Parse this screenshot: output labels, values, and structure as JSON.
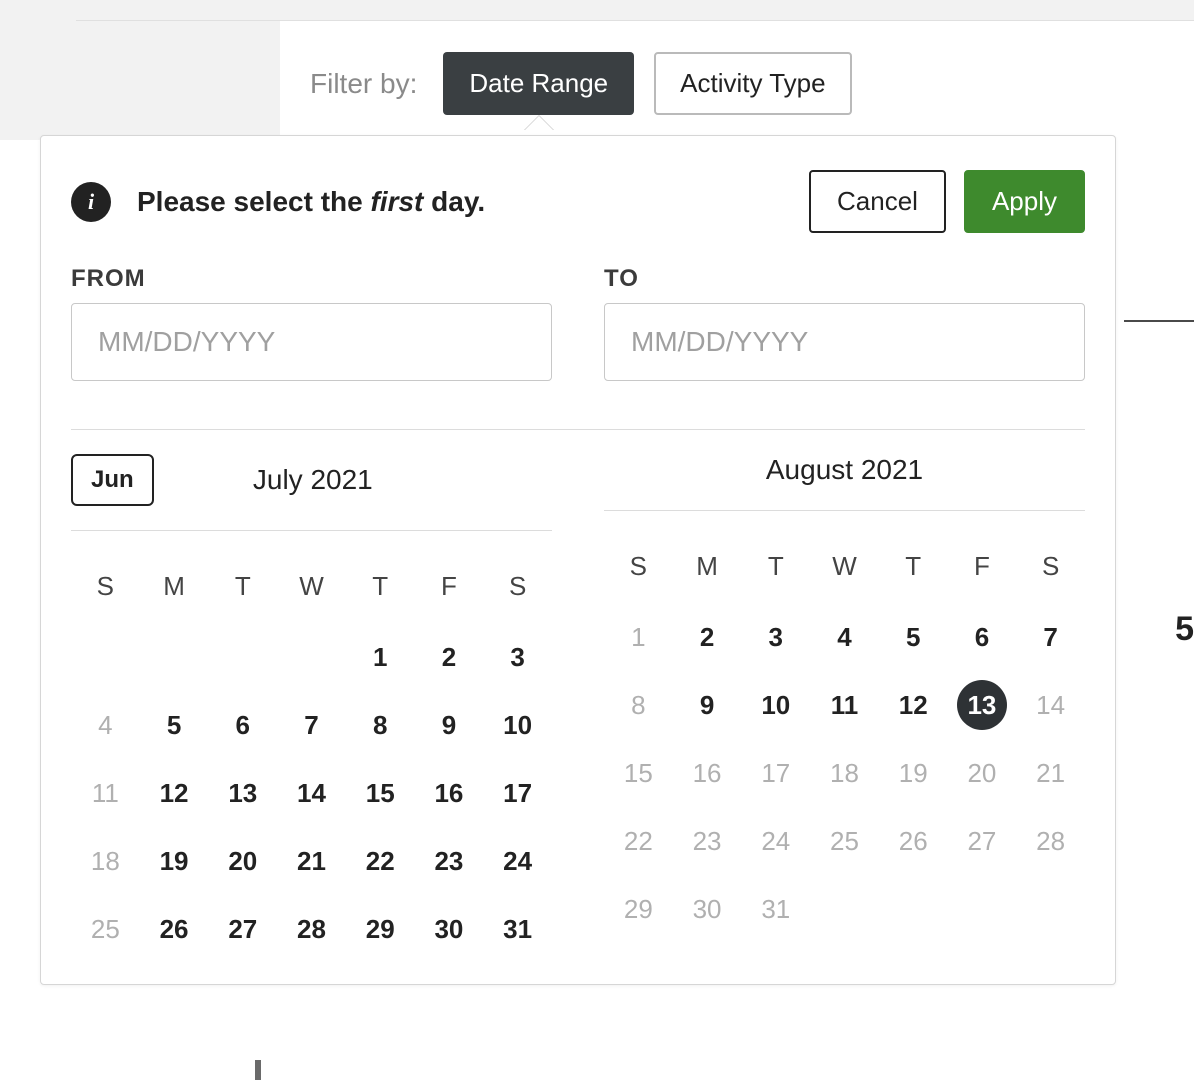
{
  "filter": {
    "label": "Filter by:",
    "buttons": {
      "date_range": "Date Range",
      "activity_type": "Activity Type"
    }
  },
  "popover": {
    "info_prefix": "Please select the ",
    "info_em": "first",
    "info_suffix": " day.",
    "cancel": "Cancel",
    "apply": "Apply",
    "from_label": "FROM",
    "to_label": "TO",
    "from_value": "",
    "to_value": "",
    "placeholder": "MM/DD/YYYY"
  },
  "calendars": {
    "prev_label": "Jun",
    "weekdays": [
      "S",
      "M",
      "T",
      "W",
      "T",
      "F",
      "S"
    ],
    "left": {
      "title": "July 2021",
      "cells": [
        {
          "n": "",
          "t": "empty"
        },
        {
          "n": "",
          "t": "empty"
        },
        {
          "n": "",
          "t": "empty"
        },
        {
          "n": "",
          "t": "empty"
        },
        {
          "n": "1",
          "t": ""
        },
        {
          "n": "2",
          "t": ""
        },
        {
          "n": "3",
          "t": ""
        },
        {
          "n": "4",
          "t": "dim"
        },
        {
          "n": "5",
          "t": ""
        },
        {
          "n": "6",
          "t": ""
        },
        {
          "n": "7",
          "t": ""
        },
        {
          "n": "8",
          "t": ""
        },
        {
          "n": "9",
          "t": ""
        },
        {
          "n": "10",
          "t": ""
        },
        {
          "n": "11",
          "t": "dim"
        },
        {
          "n": "12",
          "t": ""
        },
        {
          "n": "13",
          "t": ""
        },
        {
          "n": "14",
          "t": ""
        },
        {
          "n": "15",
          "t": ""
        },
        {
          "n": "16",
          "t": ""
        },
        {
          "n": "17",
          "t": ""
        },
        {
          "n": "18",
          "t": "dim"
        },
        {
          "n": "19",
          "t": ""
        },
        {
          "n": "20",
          "t": ""
        },
        {
          "n": "21",
          "t": ""
        },
        {
          "n": "22",
          "t": ""
        },
        {
          "n": "23",
          "t": ""
        },
        {
          "n": "24",
          "t": ""
        },
        {
          "n": "25",
          "t": "dim"
        },
        {
          "n": "26",
          "t": ""
        },
        {
          "n": "27",
          "t": ""
        },
        {
          "n": "28",
          "t": ""
        },
        {
          "n": "29",
          "t": ""
        },
        {
          "n": "30",
          "t": ""
        },
        {
          "n": "31",
          "t": ""
        }
      ]
    },
    "right": {
      "title": "August 2021",
      "cells": [
        {
          "n": "1",
          "t": "dim"
        },
        {
          "n": "2",
          "t": ""
        },
        {
          "n": "3",
          "t": ""
        },
        {
          "n": "4",
          "t": ""
        },
        {
          "n": "5",
          "t": ""
        },
        {
          "n": "6",
          "t": ""
        },
        {
          "n": "7",
          "t": ""
        },
        {
          "n": "8",
          "t": "dim"
        },
        {
          "n": "9",
          "t": ""
        },
        {
          "n": "10",
          "t": ""
        },
        {
          "n": "11",
          "t": ""
        },
        {
          "n": "12",
          "t": ""
        },
        {
          "n": "13",
          "t": "today"
        },
        {
          "n": "14",
          "t": "dim"
        },
        {
          "n": "15",
          "t": "dim"
        },
        {
          "n": "16",
          "t": "dim"
        },
        {
          "n": "17",
          "t": "dim"
        },
        {
          "n": "18",
          "t": "dim"
        },
        {
          "n": "19",
          "t": "dim"
        },
        {
          "n": "20",
          "t": "dim"
        },
        {
          "n": "21",
          "t": "dim"
        },
        {
          "n": "22",
          "t": "dim"
        },
        {
          "n": "23",
          "t": "dim"
        },
        {
          "n": "24",
          "t": "dim"
        },
        {
          "n": "25",
          "t": "dim"
        },
        {
          "n": "26",
          "t": "dim"
        },
        {
          "n": "27",
          "t": "dim"
        },
        {
          "n": "28",
          "t": "dim"
        },
        {
          "n": "29",
          "t": "dim"
        },
        {
          "n": "30",
          "t": "dim"
        },
        {
          "n": "31",
          "t": "dim"
        },
        {
          "n": "",
          "t": "empty"
        },
        {
          "n": "",
          "t": "empty"
        },
        {
          "n": "",
          "t": "empty"
        },
        {
          "n": "",
          "t": "empty"
        }
      ]
    }
  },
  "edge": {
    "fragment": "5"
  }
}
